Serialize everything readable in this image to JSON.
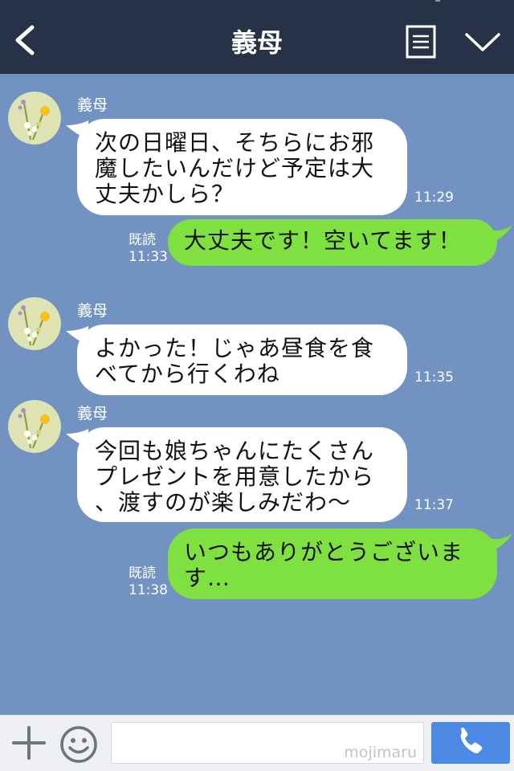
{
  "header": {
    "title": "義母",
    "back_icon": "chevron-left-icon",
    "menu_icon": "menu-icon",
    "dropdown_icon": "chevron-down-icon"
  },
  "messages": [
    {
      "direction": "incoming",
      "sender": "義母",
      "lines": [
        "次の日曜日、そちらにお邪",
        "魔したいんだけど予定は大",
        "丈夫かしら？"
      ],
      "time": "11:29"
    },
    {
      "direction": "outgoing",
      "lines": [
        "大丈夫です！空いてます！"
      ],
      "read_label": "既読",
      "time": "11:33"
    },
    {
      "direction": "incoming",
      "sender": "義母",
      "lines": [
        "よかった！じゃあ昼食を食",
        "べてから行くわね"
      ],
      "time": "11:35"
    },
    {
      "direction": "incoming",
      "sender": "義母",
      "lines": [
        "今回も娘ちゃんにたくさん",
        "プレゼントを用意したから",
        "、渡すのが楽しみだわ〜"
      ],
      "time": "11:37"
    },
    {
      "direction": "outgoing",
      "lines": [
        "いつもありがとうございま",
        "す…"
      ],
      "read_label": "既読",
      "time": "11:38"
    }
  ],
  "input": {
    "placeholder": "mojimaru",
    "value": ""
  },
  "bottom_bar": {
    "plus_icon": "plus-icon",
    "emoji_icon": "smile-icon",
    "call_icon": "phone-icon"
  },
  "colors": {
    "header_bg": "#273246",
    "chat_bg": "#7293c1",
    "incoming_bubble": "#ffffff",
    "outgoing_bubble": "#7fe140",
    "call_button": "#4d8ae6"
  }
}
